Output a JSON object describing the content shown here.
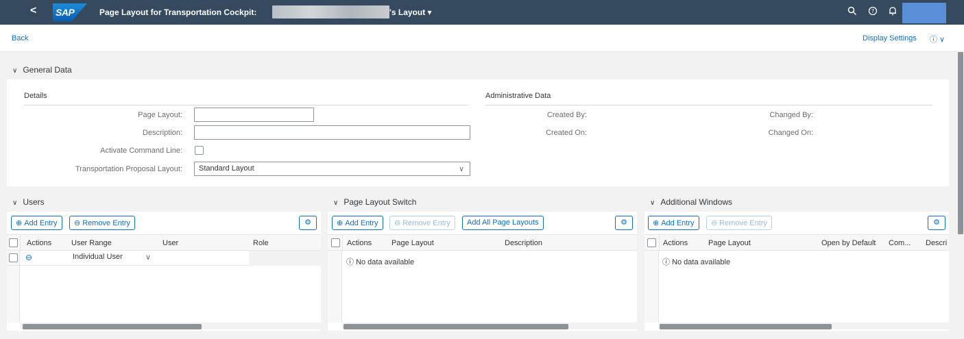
{
  "shell": {
    "back_glyph": "<",
    "logo": "SAP",
    "title_prefix": "Page Layout for Transportation Cockpit:",
    "title_suffix": "'s Layout",
    "title_dropdown_glyph": "▾",
    "icons": [
      "search-icon",
      "help-icon",
      "notification-icon"
    ]
  },
  "subheader": {
    "back": "Back",
    "display_settings": "Display Settings",
    "help_glyph": "ⓘ ∨"
  },
  "general": {
    "title": "General Data",
    "details_title": "Details",
    "admin_title": "Administrative Data",
    "labels": {
      "page_layout": "Page Layout:",
      "description": "Description:",
      "activate_cmd": "Activate Command Line:",
      "tp_layout": "Transportation Proposal Layout:",
      "created_by": "Created By:",
      "created_on": "Created On:",
      "changed_by": "Changed By:",
      "changed_on": "Changed On:"
    },
    "values": {
      "page_layout": "",
      "description": "",
      "tp_layout": "Standard Layout"
    }
  },
  "users": {
    "title": "Users",
    "add": "Add Entry",
    "remove": "Remove Entry",
    "columns": [
      "Actions",
      "User Range",
      "User",
      "Role"
    ],
    "rows": [
      {
        "user_range": "Individual User",
        "user": "",
        "role": ""
      }
    ]
  },
  "page_switch": {
    "title": "Page Layout Switch",
    "add": "Add Entry",
    "remove": "Remove Entry",
    "add_all": "Add All Page Layouts",
    "columns": [
      "Actions",
      "Page Layout",
      "Description"
    ],
    "empty": "No data available"
  },
  "additional": {
    "title": "Additional Windows",
    "add": "Add Entry",
    "remove": "Remove Entry",
    "columns": [
      "Actions",
      "Page Layout",
      "Open by Default",
      "Com...",
      "Descri"
    ],
    "empty": "No data available"
  },
  "colors": {
    "shell": "#354a5f",
    "accent": "#0a6ed1"
  }
}
